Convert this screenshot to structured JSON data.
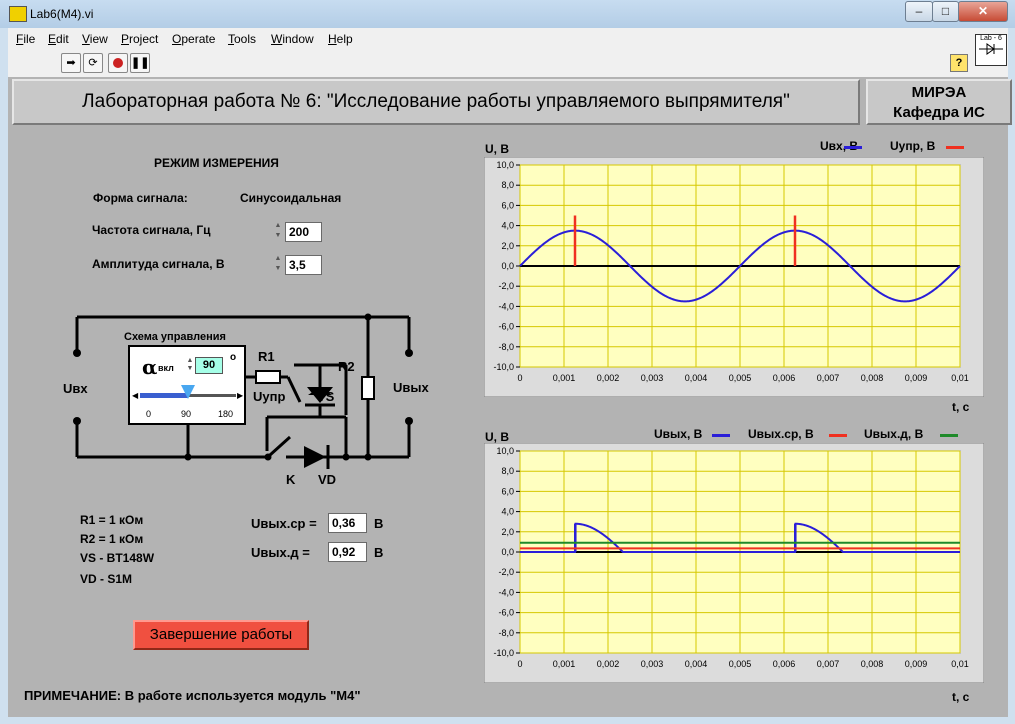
{
  "window": {
    "title": "Lab6(M4).vi",
    "min": "–",
    "max": "□",
    "close": "✕"
  },
  "menu": [
    {
      "label": "File",
      "key": "F",
      "rest": "ile"
    },
    {
      "label": "Edit",
      "key": "E",
      "rest": "dit"
    },
    {
      "label": "View",
      "key": "V",
      "rest": "iew"
    },
    {
      "label": "Project",
      "key": "P",
      "rest": "roject"
    },
    {
      "label": "Operate",
      "key": "O",
      "rest": "perate"
    },
    {
      "label": "Tools",
      "key": "T",
      "rest": "ools"
    },
    {
      "label": "Window",
      "key": "W",
      "rest": "indow"
    },
    {
      "label": "Help",
      "key": "H",
      "rest": "elp"
    }
  ],
  "toolbar": {
    "run_icon": "run-arrow-icon",
    "cont_icon": "run-continuously-icon",
    "abort_icon": "abort-icon",
    "pause_icon": "pause-icon",
    "help": "?",
    "vi_icon_label": "Lab - 6"
  },
  "header": {
    "title": "Лабораторная работа № 6: \"Исследование работы управляемого выпрямителя\"",
    "org_line1": "МИРЭА",
    "org_line2": "Кафедра ИС"
  },
  "mode": {
    "heading": "РЕЖИМ ИЗМЕРЕНИЯ",
    "signal_form_label": "Форма сигнала:",
    "signal_form_value": "Синусоидальная",
    "freq_label": "Частота сигнала, Гц",
    "freq_value": "200",
    "amp_label": "Амплитуда сигнала, В",
    "amp_value": "3,5"
  },
  "circuit": {
    "control_title": "Схема управления",
    "alpha_symbol": "α",
    "alpha_sub": "вкл",
    "alpha_value": "90",
    "alpha_unit": "о",
    "slider_min": "0",
    "slider_mid": "90",
    "slider_max": "180",
    "slider_value": 90,
    "uin": "Uвх",
    "uout": "Uвых",
    "r1": "R1",
    "r2": "R2",
    "uupr": "Uупр",
    "vs": "VS",
    "k": "K",
    "vd": "VD"
  },
  "components": {
    "line1": "R1 = 1 кОм",
    "line2": "R2 = 1 кОм",
    "line3": "VS - BT148W",
    "line4": "VD - S1M"
  },
  "outputs": {
    "avg_label": "Uвых.ср =",
    "avg_value": "0,36",
    "avg_unit": "В",
    "rms_label": "Uвых.д =",
    "rms_value": "0,92",
    "rms_unit": "В"
  },
  "exit_button": "Завершение работы",
  "note": "ПРИМЕЧАНИЕ: В работе используется модуль \"М4\"",
  "colors": {
    "panel": "#b3b3b3",
    "plot_bg": "#ffffc0",
    "grid": "#d6c800",
    "series_blue": "#2a1ed8",
    "series_red": "#f03020",
    "series_green": "#1f8a2a",
    "exit_button": "#f05040"
  },
  "chart_data": [
    {
      "type": "line",
      "ylabel": "U, В",
      "xlabel": "t, с",
      "xlim": [
        0,
        0.01
      ],
      "ylim": [
        -10,
        10
      ],
      "x_ticks": [
        "0",
        "0,001",
        "0,002",
        "0,003",
        "0,004",
        "0,005",
        "0,006",
        "0,007",
        "0,008",
        "0,009",
        "0,01"
      ],
      "y_ticks": [
        "10,0",
        "8,0",
        "6,0",
        "4,0",
        "2,0",
        "0,0",
        "-2,0",
        "-4,0",
        "-6,0",
        "-8,0",
        "-10,0"
      ],
      "grid": true,
      "legend": "top-right",
      "series": [
        {
          "name": "Uвх, В",
          "color": "#2a1ed8",
          "kind": "sine",
          "amplitude": 3.5,
          "frequency": 200
        },
        {
          "name": "Uупр, В",
          "color": "#f03020",
          "kind": "pulses",
          "x": [
            0.00125,
            0.00625
          ],
          "height": 5.0
        }
      ]
    },
    {
      "type": "line",
      "ylabel": "U, В",
      "xlabel": "t, с",
      "xlim": [
        0,
        0.01
      ],
      "ylim": [
        -10,
        10
      ],
      "x_ticks": [
        "0",
        "0,001",
        "0,002",
        "0,003",
        "0,004",
        "0,005",
        "0,006",
        "0,007",
        "0,008",
        "0,009",
        "0,01"
      ],
      "y_ticks": [
        "10,0",
        "8,0",
        "6,0",
        "4,0",
        "2,0",
        "0,0",
        "-2,0",
        "-4,0",
        "-6,0",
        "-8,0",
        "-10,0"
      ],
      "grid": true,
      "legend": "top-right",
      "series": [
        {
          "name": "Uвых, В",
          "color": "#2a1ed8",
          "kind": "rectified",
          "amplitude": 3.5,
          "frequency": 200,
          "alpha_deg": 90,
          "drop": 0.7
        },
        {
          "name": "Uвых.ср, В",
          "color": "#f03020",
          "kind": "constant",
          "value": 0.36
        },
        {
          "name": "Uвых.д, В",
          "color": "#1f8a2a",
          "kind": "constant",
          "value": 0.92
        }
      ]
    }
  ]
}
